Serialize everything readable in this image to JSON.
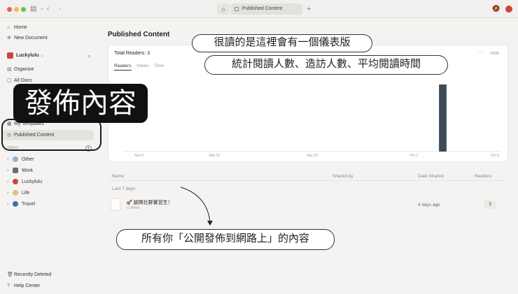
{
  "window": {
    "tab_title": "Published Content",
    "tab_icons": {
      "home": "home-icon",
      "add": "plus-icon"
    }
  },
  "sidebar": {
    "home": "Home",
    "new_document": "New Document",
    "workspace": "Luckylulu",
    "organize": "Organize",
    "all_docs": "All Docs",
    "my_templates": "My Templates",
    "published_content": "Published Content",
    "section_label": "olders",
    "folders": [
      {
        "name": "Other",
        "color": "#8fb3d9"
      },
      {
        "name": "Work",
        "color": "#6b6b6b"
      },
      {
        "name": "Luckylulu",
        "color": "#c9463d"
      },
      {
        "name": "Life",
        "color": "#e0c27a"
      },
      {
        "name": "Travel",
        "color": "#3b6fb6"
      }
    ],
    "recently_deleted": "Recently Deleted",
    "help_center": "Help Center"
  },
  "main": {
    "page_title": "Published Content",
    "card": {
      "total_readers": "Total Readers: 3",
      "hide": "Hide",
      "more": "···",
      "tabs": [
        "Readers",
        "Views",
        "Time"
      ]
    },
    "table": {
      "columns": [
        "Name",
        "Shared by",
        "Date Shared",
        "Readers"
      ],
      "group": "Last 7 days",
      "rows": [
        {
          "title": "🚀 誠徵社群實習生！",
          "folder": "Work",
          "date_shared": "4 days ago",
          "readers": "3"
        }
      ]
    }
  },
  "chart_data": {
    "type": "bar",
    "x_ticks": [
      "Sep 9",
      "Sep 16",
      "Sep 23",
      "Oct 1",
      "Oct 8"
    ],
    "series": [
      {
        "values": [
          0,
          0,
          0,
          0,
          0,
          0,
          0,
          0,
          0,
          0,
          0,
          0,
          0,
          0,
          0,
          0,
          0,
          0,
          0,
          0,
          0,
          0,
          0,
          0,
          0,
          3,
          0,
          0,
          0,
          0
        ]
      }
    ],
    "ylim": [
      0,
      3
    ],
    "grid": false,
    "bar_color": "#3d4a55"
  },
  "annotations": {
    "bubble_1": "很讀的是這裡會有一個儀表版",
    "bubble_2": "統計閱讀人數、造訪人數、平均閱讀時間",
    "bubble_3": "所有你「公開發佈到網路上」的內容",
    "big_label": "發佈內容"
  }
}
